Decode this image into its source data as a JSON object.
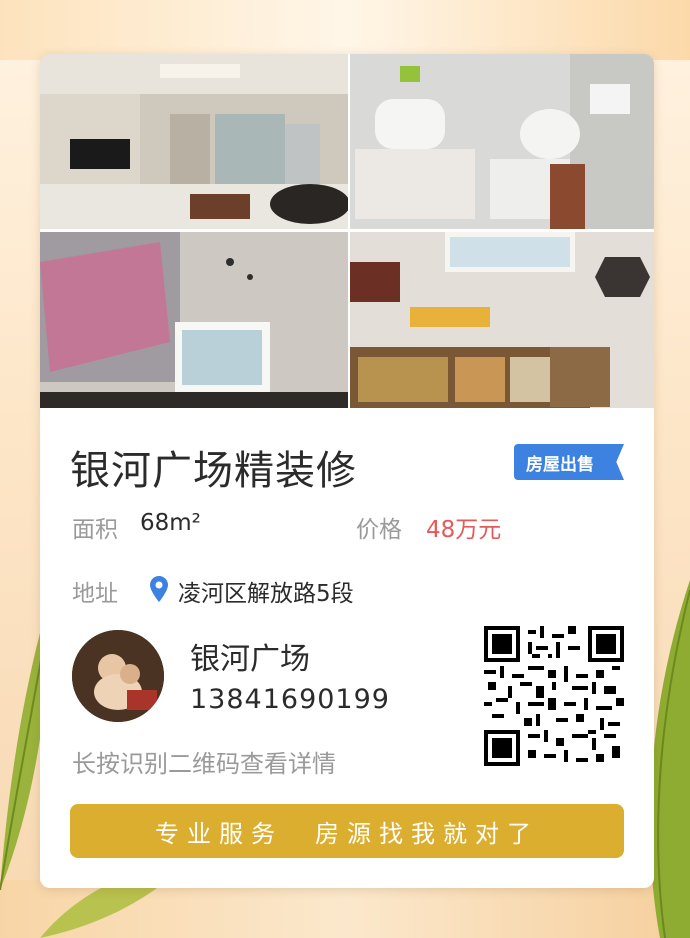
{
  "listing": {
    "title": "银河广场精装修",
    "badge": "房屋出售",
    "area_label": "面积",
    "area_value": "68m²",
    "price_label": "价格",
    "price_value": "48万元",
    "address_label": "地址",
    "address_value": "凌河区解放路5段"
  },
  "contact": {
    "name": "银河广场",
    "phone": "13841690199",
    "hint": "长按识别二维码查看详情"
  },
  "slogan": "专业服务　房源找我就对了",
  "photos": [
    "living-room",
    "bathroom",
    "bedroom",
    "study-room"
  ],
  "colors": {
    "badge": "#3d82e0",
    "price": "#e6595a",
    "slogan_bg": "#dcae2f",
    "pin": "#3d82e0"
  }
}
